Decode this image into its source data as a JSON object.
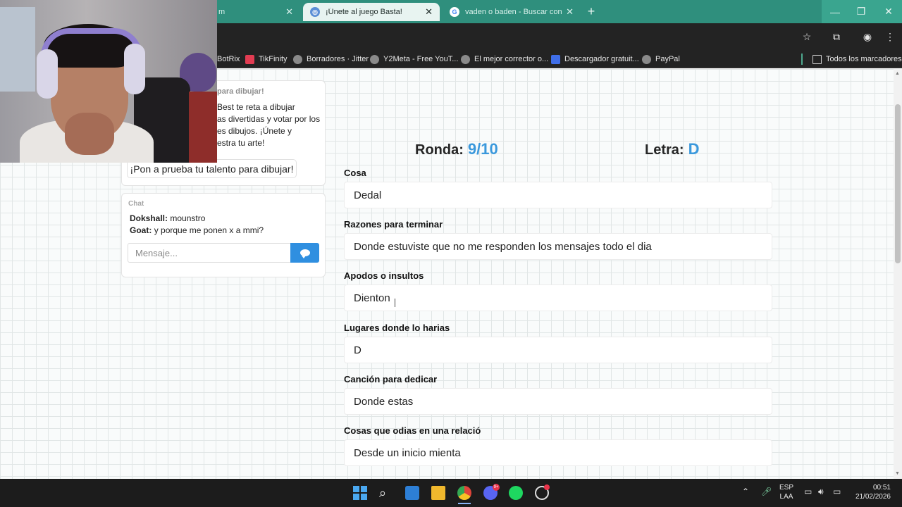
{
  "browser": {
    "tabs": [
      {
        "title": "m",
        "active": false
      },
      {
        "title": "¡Únete al juego Basta!",
        "active": true
      },
      {
        "title": "vaden o baden - Buscar con Google",
        "active": false
      }
    ],
    "bookmarks": [
      {
        "label": "BotRix"
      },
      {
        "label": "TikFinity"
      },
      {
        "label": "Borradores · Jitter"
      },
      {
        "label": "Y2Meta - Free YouT..."
      },
      {
        "label": "El mejor corrector o..."
      },
      {
        "label": "Descargador gratuit..."
      },
      {
        "label": "PayPal"
      }
    ],
    "all_bookmarks": "Todos los marcadores"
  },
  "info": {
    "title": "para dibujar!",
    "lines": [
      "Best te reta a dibujar",
      "as divertidas y votar por los",
      "es dibujos. ¡Únete y",
      "estra tu arte!"
    ],
    "cta": "¡Pon a prueba tu talento para dibujar!"
  },
  "chat": {
    "title": "Chat",
    "messages": [
      {
        "user": "Dokshall:",
        "text": "mounstro"
      },
      {
        "user": "Goat:",
        "text": "y porque me ponen x a mmi?"
      }
    ],
    "placeholder": "Mensaje..."
  },
  "game": {
    "round_label": "Ronda:",
    "round_value": "9/10",
    "letter_label": "Letra:",
    "letter_value": "D",
    "fields": [
      {
        "label": "Cosa",
        "value": "Dedal"
      },
      {
        "label": "Razones para terminar",
        "value": "Donde estuviste que no me responden los mensajes todo el dia"
      },
      {
        "label": "Apodos o insultos",
        "value": "Dienton"
      },
      {
        "label": "Lugares donde lo harias",
        "value": "D"
      },
      {
        "label": "Canción para dedicar",
        "value": "Donde estas"
      },
      {
        "label": "Cosas que odias en una relació",
        "value": "Desde un inicio mienta"
      }
    ]
  },
  "taskbar": {
    "lang": "ESP",
    "region": "LAA",
    "time": "00:51",
    "date": "21/02/2026",
    "discord_badge": "9+"
  }
}
